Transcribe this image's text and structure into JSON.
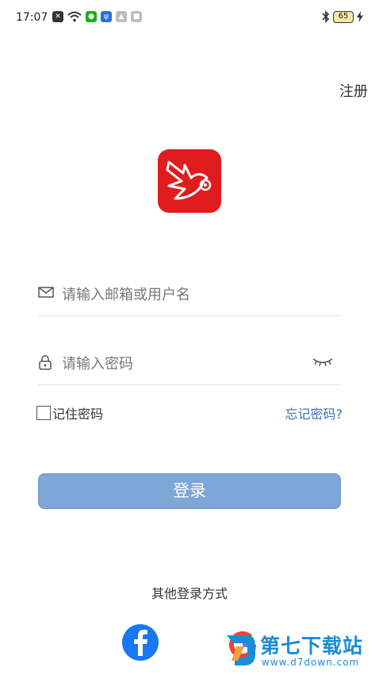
{
  "status_bar": {
    "time": "17:07",
    "battery": "65",
    "icons": [
      "notification-icon",
      "wifi-icon",
      "wechat-icon",
      "usb-icon",
      "app-icon",
      "app-icon"
    ]
  },
  "header": {
    "register_label": "注册"
  },
  "login_form": {
    "username_placeholder": "请输入邮箱或用户名",
    "password_placeholder": "请输入密码",
    "remember_label": "记住密码",
    "forgot_label": "忘记密码?",
    "login_button": "登录"
  },
  "other_login": {
    "title": "其他登录方式",
    "providers": [
      "facebook",
      "google"
    ]
  },
  "watermark": {
    "title": "第七下载站",
    "url": "www.d7down.com"
  },
  "colors": {
    "brand_red": "#e11c1c",
    "button_blue": "#7ea6d6",
    "link_blue": "#3d6fb2",
    "facebook": "#1877f2"
  }
}
